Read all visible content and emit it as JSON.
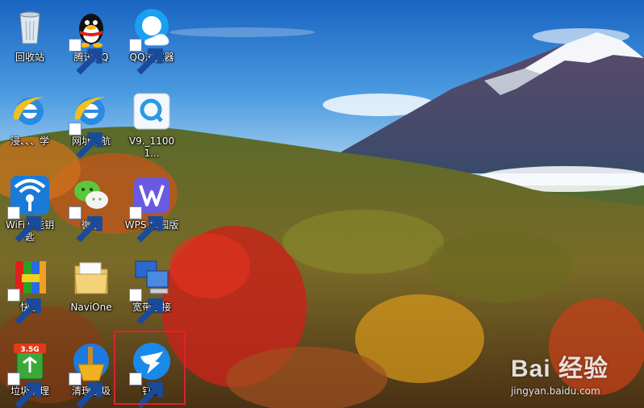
{
  "desktop": {
    "icons": [
      {
        "label": "回收站",
        "icon": "recycle-bin-icon"
      },
      {
        "label": "腾讯QQ",
        "icon": "qq-penguin-icon"
      },
      {
        "label": "QQ浏览器",
        "icon": "qq-browser-icon"
      },
      {
        "label": "浸、、、学",
        "icon": "ie-icon"
      },
      {
        "label": "网址导航",
        "icon": "ie-icon"
      },
      {
        "label": "V9._11001...",
        "icon": "qq-search-icon"
      },
      {
        "label": "WiFi万能钥匙",
        "icon": "wifi-key-icon"
      },
      {
        "label": "微信",
        "icon": "wechat-icon"
      },
      {
        "label": "WPS 校园版",
        "icon": "wps-icon"
      },
      {
        "label": "快压",
        "icon": "kuaiya-icon"
      },
      {
        "label": "NaviOne",
        "icon": "folder-icon"
      },
      {
        "label": "宽带连接",
        "icon": "network-icon"
      },
      {
        "label": "垃圾清理",
        "icon": "cleaner-3.5g-icon"
      },
      {
        "label": "清理垃圾",
        "icon": "broom-icon"
      },
      {
        "label": "钉钉",
        "icon": "dingtalk-icon"
      }
    ],
    "cleaner_badge": "3.5G"
  },
  "watermark": {
    "main": "Bai  经验",
    "sub": "jingyan.baidu.com"
  },
  "colors": {
    "highlight": "#e0202a",
    "sky": "#2f7fd0"
  }
}
